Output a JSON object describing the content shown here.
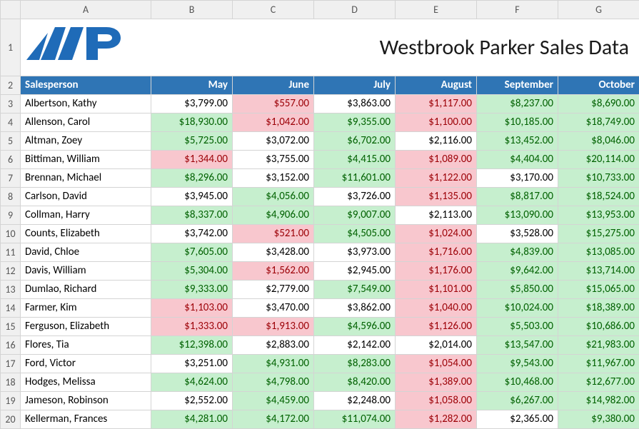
{
  "title": "Westbrook Parker Sales Data",
  "columns_letters": [
    "A",
    "B",
    "C",
    "D",
    "E",
    "F",
    "G"
  ],
  "header_row_num": 2,
  "first_data_row_num": 3,
  "headers": [
    "Salesperson",
    "May",
    "June",
    "July",
    "August",
    "September",
    "October"
  ],
  "rows": [
    {
      "name": "Albertson, Kathy",
      "vals": [
        "$3,799.00",
        "$557.00",
        "$3,863.00",
        "$1,117.00",
        "$8,237.00",
        "$8,690.00"
      ],
      "hl": [
        "",
        "red",
        "",
        "red",
        "green",
        "green"
      ]
    },
    {
      "name": "Allenson, Carol",
      "vals": [
        "$18,930.00",
        "$1,042.00",
        "$9,355.00",
        "$1,100.00",
        "$10,185.00",
        "$18,749.00"
      ],
      "hl": [
        "green",
        "red",
        "green",
        "red",
        "green",
        "green"
      ]
    },
    {
      "name": "Altman, Zoey",
      "vals": [
        "$5,725.00",
        "$3,072.00",
        "$6,702.00",
        "$2,116.00",
        "$13,452.00",
        "$8,046.00"
      ],
      "hl": [
        "green",
        "",
        "green",
        "",
        "green",
        "green"
      ]
    },
    {
      "name": "Bittiman, William",
      "vals": [
        "$1,344.00",
        "$3,755.00",
        "$4,415.00",
        "$1,089.00",
        "$4,404.00",
        "$20,114.00"
      ],
      "hl": [
        "red",
        "",
        "green",
        "red",
        "green",
        "green"
      ]
    },
    {
      "name": "Brennan, Michael",
      "vals": [
        "$8,296.00",
        "$3,152.00",
        "$11,601.00",
        "$1,122.00",
        "$3,170.00",
        "$10,733.00"
      ],
      "hl": [
        "green",
        "",
        "green",
        "red",
        "",
        "green"
      ]
    },
    {
      "name": "Carlson, David",
      "vals": [
        "$3,945.00",
        "$4,056.00",
        "$3,726.00",
        "$1,135.00",
        "$8,817.00",
        "$18,524.00"
      ],
      "hl": [
        "",
        "green",
        "",
        "red",
        "green",
        "green"
      ]
    },
    {
      "name": "Collman, Harry",
      "vals": [
        "$8,337.00",
        "$4,906.00",
        "$9,007.00",
        "$2,113.00",
        "$13,090.00",
        "$13,953.00"
      ],
      "hl": [
        "green",
        "green",
        "green",
        "",
        "green",
        "green"
      ]
    },
    {
      "name": "Counts, Elizabeth",
      "vals": [
        "$3,742.00",
        "$521.00",
        "$4,505.00",
        "$1,024.00",
        "$3,528.00",
        "$15,275.00"
      ],
      "hl": [
        "",
        "red",
        "green",
        "red",
        "",
        "green"
      ]
    },
    {
      "name": "David, Chloe",
      "vals": [
        "$7,605.00",
        "$3,428.00",
        "$3,973.00",
        "$1,716.00",
        "$4,839.00",
        "$13,085.00"
      ],
      "hl": [
        "green",
        "",
        "",
        "red",
        "green",
        "green"
      ]
    },
    {
      "name": "Davis, William",
      "vals": [
        "$5,304.00",
        "$1,562.00",
        "$2,945.00",
        "$1,176.00",
        "$9,642.00",
        "$13,714.00"
      ],
      "hl": [
        "green",
        "red",
        "",
        "red",
        "green",
        "green"
      ]
    },
    {
      "name": "Dumlao, Richard",
      "vals": [
        "$9,333.00",
        "$2,779.00",
        "$7,549.00",
        "$1,101.00",
        "$5,850.00",
        "$15,065.00"
      ],
      "hl": [
        "green",
        "",
        "green",
        "red",
        "green",
        "green"
      ]
    },
    {
      "name": "Farmer, Kim",
      "vals": [
        "$1,103.00",
        "$3,470.00",
        "$3,862.00",
        "$1,040.00",
        "$10,024.00",
        "$18,389.00"
      ],
      "hl": [
        "red",
        "",
        "",
        "red",
        "green",
        "green"
      ]
    },
    {
      "name": "Ferguson, Elizabeth",
      "vals": [
        "$1,333.00",
        "$1,913.00",
        "$4,596.00",
        "$1,126.00",
        "$5,503.00",
        "$10,686.00"
      ],
      "hl": [
        "red",
        "red",
        "green",
        "red",
        "green",
        "green"
      ]
    },
    {
      "name": "Flores, Tia",
      "vals": [
        "$12,398.00",
        "$2,883.00",
        "$2,142.00",
        "$2,014.00",
        "$13,547.00",
        "$21,983.00"
      ],
      "hl": [
        "green",
        "",
        "",
        "",
        "green",
        "green"
      ]
    },
    {
      "name": "Ford, Victor",
      "vals": [
        "$3,251.00",
        "$4,931.00",
        "$8,283.00",
        "$1,054.00",
        "$9,543.00",
        "$11,967.00"
      ],
      "hl": [
        "",
        "green",
        "green",
        "red",
        "green",
        "green"
      ]
    },
    {
      "name": "Hodges, Melissa",
      "vals": [
        "$4,624.00",
        "$4,798.00",
        "$8,420.00",
        "$1,389.00",
        "$10,468.00",
        "$12,677.00"
      ],
      "hl": [
        "green",
        "green",
        "green",
        "red",
        "green",
        "green"
      ]
    },
    {
      "name": "Jameson, Robinson",
      "vals": [
        "$2,552.00",
        "$4,459.00",
        "$2,248.00",
        "$1,058.00",
        "$6,267.00",
        "$14,982.00"
      ],
      "hl": [
        "",
        "green",
        "",
        "red",
        "green",
        "green"
      ]
    },
    {
      "name": "Kellerman, Frances",
      "vals": [
        "$4,281.00",
        "$4,172.00",
        "$11,074.00",
        "$1,282.00",
        "$2,365.00",
        "$9,380.00"
      ],
      "hl": [
        "green",
        "green",
        "green",
        "red",
        "",
        "green"
      ]
    }
  ],
  "chart_data": {
    "type": "table",
    "title": "Westbrook Parker Sales Data",
    "columns": [
      "Salesperson",
      "May",
      "June",
      "July",
      "August",
      "September",
      "October"
    ],
    "data": [
      [
        "Albertson, Kathy",
        3799,
        557,
        3863,
        1117,
        8237,
        8690
      ],
      [
        "Allenson, Carol",
        18930,
        1042,
        9355,
        1100,
        10185,
        18749
      ],
      [
        "Altman, Zoey",
        5725,
        3072,
        6702,
        2116,
        13452,
        8046
      ],
      [
        "Bittiman, William",
        1344,
        3755,
        4415,
        1089,
        4404,
        20114
      ],
      [
        "Brennan, Michael",
        8296,
        3152,
        11601,
        1122,
        3170,
        10733
      ],
      [
        "Carlson, David",
        3945,
        4056,
        3726,
        1135,
        8817,
        18524
      ],
      [
        "Collman, Harry",
        8337,
        4906,
        9007,
        2113,
        13090,
        13953
      ],
      [
        "Counts, Elizabeth",
        3742,
        521,
        4505,
        1024,
        3528,
        15275
      ],
      [
        "David, Chloe",
        7605,
        3428,
        3973,
        1716,
        4839,
        13085
      ],
      [
        "Davis, William",
        5304,
        1562,
        2945,
        1176,
        9642,
        13714
      ],
      [
        "Dumlao, Richard",
        9333,
        2779,
        7549,
        1101,
        5850,
        15065
      ],
      [
        "Farmer, Kim",
        1103,
        3470,
        3862,
        1040,
        10024,
        18389
      ],
      [
        "Ferguson, Elizabeth",
        1333,
        1913,
        4596,
        1126,
        5503,
        10686
      ],
      [
        "Flores, Tia",
        12398,
        2883,
        2142,
        2014,
        13547,
        21983
      ],
      [
        "Ford, Victor",
        3251,
        4931,
        8283,
        1054,
        9543,
        11967
      ],
      [
        "Hodges, Melissa",
        4624,
        4798,
        8420,
        1389,
        10468,
        12677
      ],
      [
        "Jameson, Robinson",
        2552,
        4459,
        2248,
        1058,
        6267,
        14982
      ],
      [
        "Kellerman, Frances",
        4281,
        4172,
        11074,
        1282,
        2365,
        9380
      ]
    ]
  }
}
